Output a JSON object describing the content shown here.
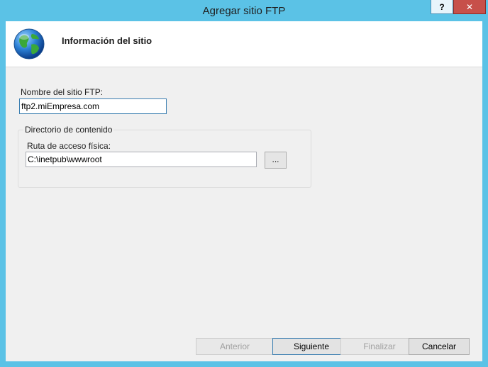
{
  "window": {
    "title": "Agregar sitio FTP",
    "help_label": "?",
    "close_label": "✕",
    "accent_color": "#5bc2e6"
  },
  "header": {
    "title": "Información del sitio",
    "icon": "globe-icon"
  },
  "site_name": {
    "label": "Nombre del sitio FTP:",
    "value": "ftp2.miEmpresa.com"
  },
  "content_directory": {
    "group_title": "Directorio de contenido",
    "path_label": "Ruta de acceso física:",
    "path_value": "C:\\inetpub\\wwwroot",
    "browse_label": "..."
  },
  "footer": {
    "back_label": "Anterior",
    "next_label": "Siguiente",
    "finish_label": "Finalizar",
    "cancel_label": "Cancelar"
  }
}
